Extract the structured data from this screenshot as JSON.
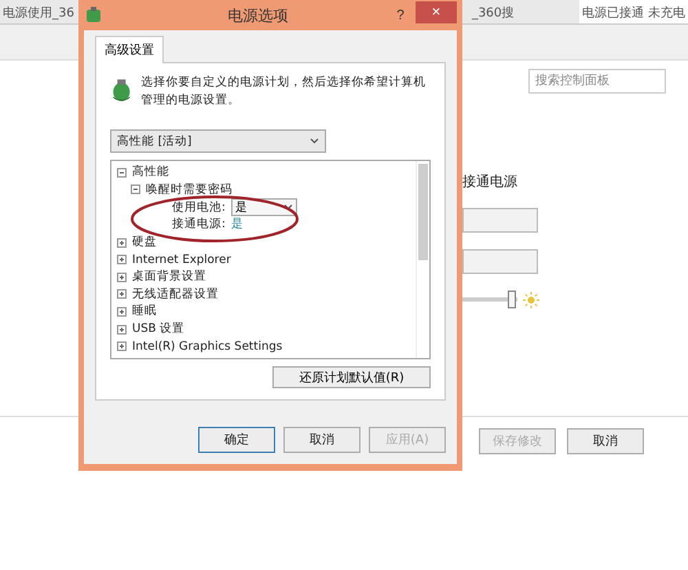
{
  "browser_tabs": [
    {
      "label": "电源使用_36",
      "selected": false
    },
    {
      "label": "_360搜",
      "selected": false
    },
    {
      "label": "电源已接通 未充电",
      "selected": true
    }
  ],
  "background": {
    "search": {
      "placeholder": "搜索控制面板"
    },
    "column_label": "接通电源",
    "brightness": {
      "level": 0.9
    },
    "buttons": [
      {
        "label": "保存修改",
        "disabled": true
      },
      {
        "label": "取消",
        "disabled": false
      }
    ]
  },
  "dialog": {
    "title": "电源选项",
    "help": "?",
    "close": "×",
    "tabs": [
      {
        "label": "高级设置",
        "selected": true
      }
    ],
    "description": "选择你要自定义的电源计划，然后选择你希望计算机管理的电源设置。",
    "plan": "高性能 [活动]",
    "tree": [
      {
        "label": "高性能",
        "expanded": true,
        "children": [
          {
            "label": "唤醒时需要密码",
            "expanded": true,
            "settings": [
              {
                "kind": "dropdown",
                "label": "使用电池:",
                "value": "是"
              },
              {
                "kind": "value",
                "label": "接通电源:",
                "value": "是"
              }
            ]
          }
        ]
      },
      {
        "label": "硬盘",
        "expanded": false
      },
      {
        "label": "Internet Explorer",
        "expanded": false
      },
      {
        "label": "桌面背景设置",
        "expanded": false
      },
      {
        "label": "无线适配器设置",
        "expanded": false
      },
      {
        "label": "睡眠",
        "expanded": false
      },
      {
        "label": "USB 设置",
        "expanded": false
      },
      {
        "label": "Intel(R) Graphics Settings",
        "expanded": false
      }
    ],
    "restore": "还原计划默认值(R)",
    "buttons": [
      {
        "label": "确定",
        "disabled": false,
        "default": true
      },
      {
        "label": "取消",
        "disabled": false,
        "default": false
      },
      {
        "label": "应用(A)",
        "disabled": true,
        "default": false
      }
    ]
  }
}
